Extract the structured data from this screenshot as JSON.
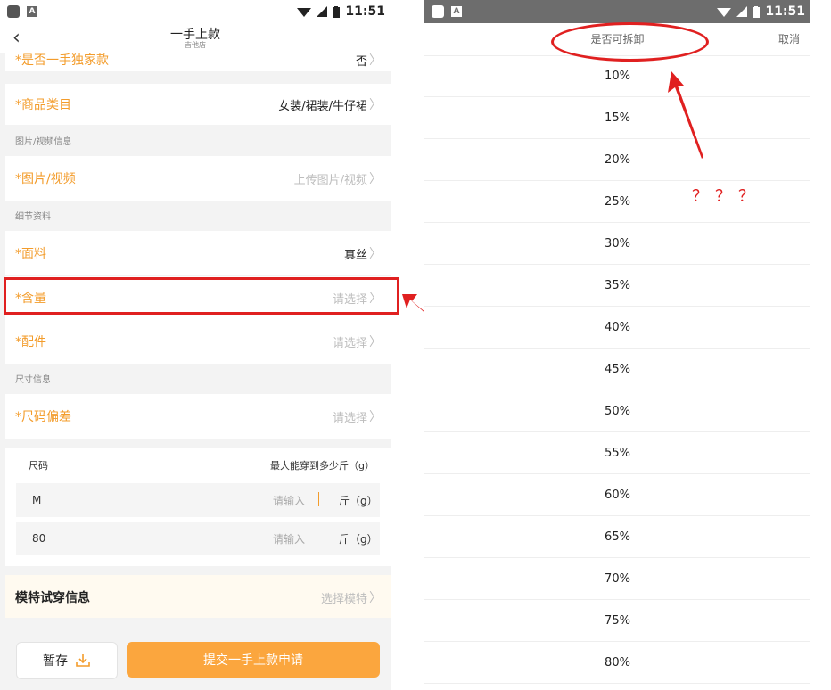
{
  "left": {
    "status": {
      "time": "11:51"
    },
    "header": {
      "back": "‹",
      "title": "一手上款",
      "subtitle": "吉他店"
    },
    "rows": {
      "exclusive": {
        "label": "*是否一手独家款",
        "value": "否"
      },
      "category": {
        "label": "*商品类目",
        "value": "女装/裙装/牛仔裙"
      },
      "media": {
        "label": "*图片/视频",
        "value": "上传图片/视频"
      },
      "fabric": {
        "label": "*面料",
        "value": "真丝"
      },
      "content": {
        "label": "*含量",
        "value": "请选择"
      },
      "accessories": {
        "label": "*配件",
        "value": "请选择"
      },
      "size_dev": {
        "label": "*尺码偏差",
        "value": "请选择"
      }
    },
    "sections": {
      "media": "图片/视频信息",
      "detail": "细节资料",
      "size": "尺寸信息"
    },
    "size_table": {
      "col_size": "尺码",
      "col_max": "最大能穿到多少斤（g）",
      "rows": [
        {
          "size": "M",
          "placeholder": "请输入",
          "unit": "斤（g）"
        },
        {
          "size": "80",
          "placeholder": "请输入",
          "unit": "斤（g）"
        }
      ]
    },
    "model": {
      "label": "模特试穿信息",
      "value": "选择模特"
    },
    "buttons": {
      "save": "暂存",
      "submit": "提交一手上款申请"
    }
  },
  "right": {
    "status": {
      "time": "11:51"
    },
    "picker": {
      "title": "是否可拆卸",
      "cancel": "取消",
      "options": [
        "10%",
        "15%",
        "20%",
        "25%",
        "30%",
        "35%",
        "40%",
        "45%",
        "50%",
        "55%",
        "60%",
        "65%",
        "70%",
        "75%",
        "80%"
      ]
    },
    "annotation": "？？？"
  },
  "colors": {
    "accent": "#f39c2b",
    "submit_bg": "#fba63e",
    "annotation_red": "#e02020"
  }
}
